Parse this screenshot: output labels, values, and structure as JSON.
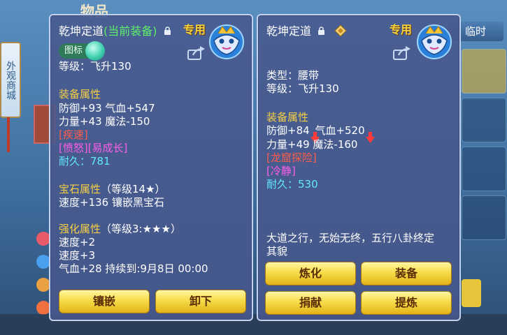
{
  "background": {
    "title": "物品",
    "temp_button": "临时",
    "side_banner": "外观商城"
  },
  "left_panel": {
    "name": "乾坤定道",
    "status": "(当前装备)",
    "badge": "专用",
    "icon_chip": "图标",
    "level": "等级：飞升130",
    "attr_header": "装备属性",
    "attr_line1": "防御+93 气血+547",
    "attr_line2": "力量+43 魔法-150",
    "special1": "[疾速]",
    "special2": "[愤怒][易成长]",
    "durability": "耐久：781",
    "gem_header": "宝石属性",
    "gem_level": "（等级14★）",
    "gem_line": "速度+136 镶嵌黑宝石",
    "strength_header": "强化属性",
    "strength_level": "（等级3:★★★）",
    "strength_line1": "速度+2",
    "strength_line2": "速度+3",
    "strength_line3": "气血+28   持续到:9月8日 00:00",
    "buttons": [
      "镶嵌",
      "卸下"
    ]
  },
  "right_panel": {
    "name": "乾坤定道",
    "badge": "专用",
    "type": "类型：腰带",
    "level": "等级：飞升130",
    "attr_header": "装备属性",
    "attr_def": "防御+84",
    "attr_hp": "气血+520",
    "attr_line2": "力量+49 魔法-160",
    "special1": "[龙窟探险]",
    "special2": "[冷静]",
    "durability": "耐久：530",
    "description_line1": "大道之行，无始无终，五行八卦终定",
    "description_line2": "其貌",
    "buttons": [
      "炼化",
      "装备",
      "捐献",
      "提炼"
    ]
  },
  "colors": {
    "attr_header": "#f5cf43",
    "special_red": "#ff5c4a",
    "special_magenta": "#ff5ee8",
    "durability_cyan": "#62e8ff",
    "button_gold": "#f7dc4a",
    "current_equip_green": "#5ef06a"
  },
  "icons": [
    "lock-icon",
    "diamond-icon",
    "share-icon",
    "mask-icon",
    "arrow-down-icon",
    "gem-ball-icon"
  ]
}
